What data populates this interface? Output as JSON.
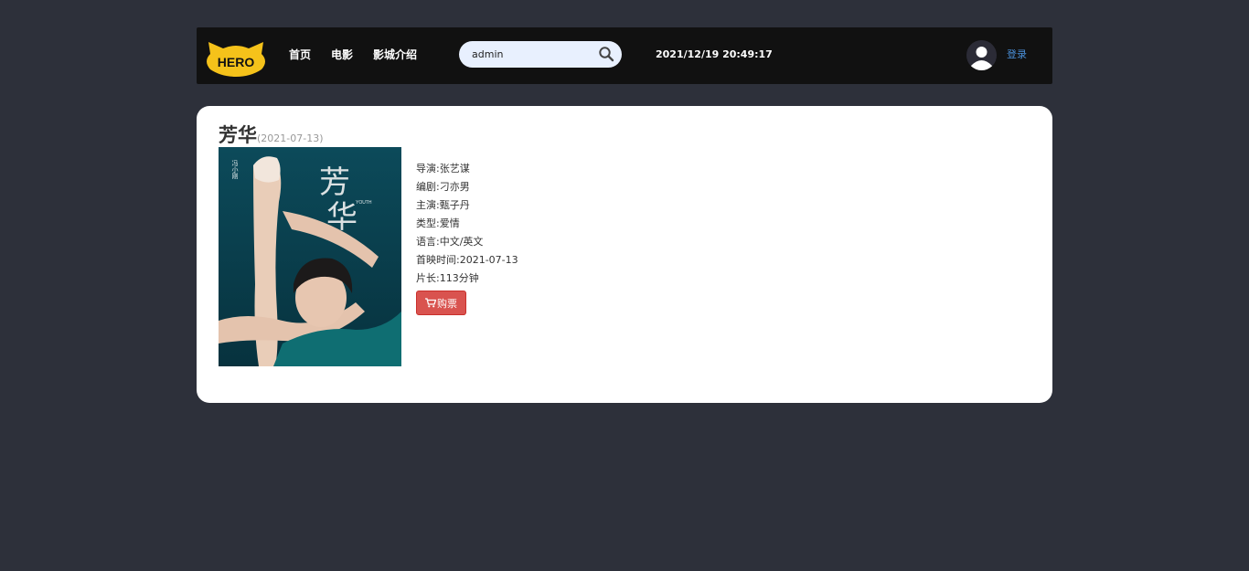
{
  "header": {
    "logo_text": "HERO",
    "nav": {
      "home": "首页",
      "movie": "电影",
      "about": "影城介绍"
    },
    "search": {
      "value": "admin",
      "icon": "search-icon"
    },
    "datetime": "2021/12/19 20:49:17",
    "login_label": "登录"
  },
  "movie": {
    "title": "芳华",
    "date": "(2021-07-13)",
    "details": {
      "director": "导演:张艺谋",
      "writer": "编剧:刁亦男",
      "cast": "主演:甄子丹",
      "genre": "类型:爱情",
      "language": "语言:中文/英文",
      "release": "首映时间:2021-07-13",
      "duration": "片长:113分钟"
    },
    "buy_label": "购票"
  },
  "colors": {
    "background": "#2d303a",
    "header": "#111111",
    "logo": "#f5c21a",
    "buy_button": "#d9534f",
    "login_link": "#4a90d9",
    "poster_bg": "#0b4150"
  }
}
